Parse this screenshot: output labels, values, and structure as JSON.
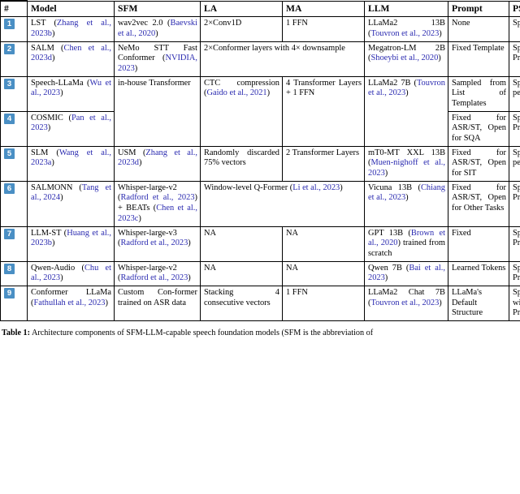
{
  "table": {
    "columns": [
      "#",
      "Model",
      "SFM",
      "LA",
      "MA",
      "LLM",
      "Prompt",
      "PSMix"
    ],
    "rows": [
      {
        "num": "1",
        "model_main": "LST (",
        "model_cite": "Zhang et al., 2023b",
        "model_tail": ")",
        "sfm_main": "wav2vec 2.0 (",
        "sfm_cite": "Baevski et al., 2020",
        "sfm_tail": ")",
        "la": "2×Conv1D",
        "ma": "1 FFN",
        "llm_main": "LLaMa2 13B (",
        "llm_cite": "Touvron et al., 2023",
        "llm_tail": ")",
        "prompt": "None",
        "psmix": "Speech Only"
      },
      {
        "num": "2",
        "model_main": "SALM (",
        "model_cite": "Chen et al., 2023d",
        "model_tail": ")",
        "sfm_main": "NeMo STT Fast Conformer (",
        "sfm_cite": "NVIDIA, 2023",
        "sfm_tail": ")",
        "la": "2×Conformer layers with 4× downsample",
        "ma": "",
        "llm_main": "Megatron-LM 2B (",
        "llm_cite": "Shoeybi et al., 2020",
        "llm_tail": ")",
        "prompt": "Fixed Template",
        "psmix": "Speech Prepended"
      },
      {
        "num": "3",
        "model_main": "Speech-LLaMa (",
        "model_cite": "Wu et al., 2023",
        "model_tail": ")",
        "prompt": "Sampled from List of Templates",
        "psmix": "Speech Ap-pended"
      },
      {
        "num": "4",
        "model_main": "COSMIC (",
        "model_cite": "Pan et al., 2023",
        "model_tail": ")",
        "prompt": "Fixed for ASR/ST, Open for SQA",
        "psmix": "Speech Prepended"
      },
      {
        "num": "5",
        "model_main": "SLM (",
        "model_cite": "Wang et al., 2023a",
        "model_tail": ")",
        "sfm_main": "USM (",
        "sfm_cite": "Zhang et al., 2023d",
        "sfm_tail": ")",
        "la": "Randomly discarded 75% vectors",
        "ma": "2 Transformer Layers",
        "llm_main": "mT0-MT XXL 13B (",
        "llm_cite": "Muen-nighoff et al., 2023",
        "llm_tail": ")",
        "prompt": "Fixed for ASR/ST, Open for SIT",
        "psmix": "Speech Ap-pended"
      },
      {
        "num": "6",
        "model_main": "SALMONN (",
        "model_cite": "Tang et al., 2024",
        "model_tail": ")",
        "sfm_main": "Whisper-large-v2 (",
        "sfm_cite": "Radford et al., 2023",
        "sfm_mid": ") + BEATs (",
        "sfm_cite2": "Chen et al., 2023c",
        "sfm_tail": ")",
        "la_main": "Window-level Q-Former (",
        "la_cite": "Li et al., 2023",
        "la_tail": ")",
        "llm_main": "Vicuna 13B (",
        "llm_cite": "Chiang et al., 2023",
        "llm_tail": ")",
        "prompt": "Fixed for ASR/ST, Open for Other Tasks",
        "psmix": "Speech Prepended"
      },
      {
        "num": "7",
        "model_main": "LLM-ST (",
        "model_cite": "Huang et al., 2023b",
        "model_tail": ")",
        "sfm_main": "Whisper-large-v3 (",
        "sfm_cite": "Radford et al., 2023",
        "sfm_tail": ")",
        "la": "NA",
        "ma": "NA",
        "llm_main": "GPT 13B (",
        "llm_cite": "Brown et al., 2020",
        "llm_tail": ") trained from scratch",
        "prompt": "Fixed",
        "psmix": "Speech Prepended"
      },
      {
        "num": "8",
        "model_main": "Qwen-Audio (",
        "model_cite": "Chu et al., 2023",
        "model_tail": ")",
        "sfm_main": "Whisper-large-v2 (",
        "sfm_cite": "Radford et al., 2023",
        "sfm_tail": ")",
        "la": "NA",
        "ma": "NA",
        "llm_main": "Qwen 7B (",
        "llm_cite": "Bai et al., 2023",
        "llm_tail": ")",
        "prompt": "Learned Tokens",
        "psmix": "Speech Prepended"
      },
      {
        "num": "9",
        "model_main": "Conformer LLaMa (",
        "model_cite": "Fathullah et al., 2023",
        "model_tail": ")",
        "sfm_main": "Custom Con-former trained on ASR data",
        "la": "Stacking 4 consecutive vectors",
        "ma": "1 FFN",
        "llm_main": "LLaMa2 Chat 7B (",
        "llm_cite": "Touvron et al., 2023",
        "llm_tail": ")",
        "prompt": "LLaMa's Default Structure",
        "psmix": "Speech Placed within the Prompt"
      }
    ],
    "merged": {
      "sfm_34": "in-house Transformer",
      "la_34_main": "CTC compression (",
      "la_34_cite": "Gaido et al., 2021",
      "la_34_tail": ")",
      "ma_34": "4 Transformer Layers + 1 FFN",
      "llm_34_main": "LLaMa2 7B (",
      "llm_34_cite": "Touvron et al., 2023",
      "llm_34_tail": ")"
    }
  },
  "caption": {
    "label": "Table 1:",
    "text": " Architecture components of SFM-LLM-capable speech foundation models (SFM is the abbreviation of"
  },
  "colors": {
    "citation_blue": "#2b2bb0",
    "badge_blue": "#4a8fc4",
    "rule": "#000000"
  }
}
